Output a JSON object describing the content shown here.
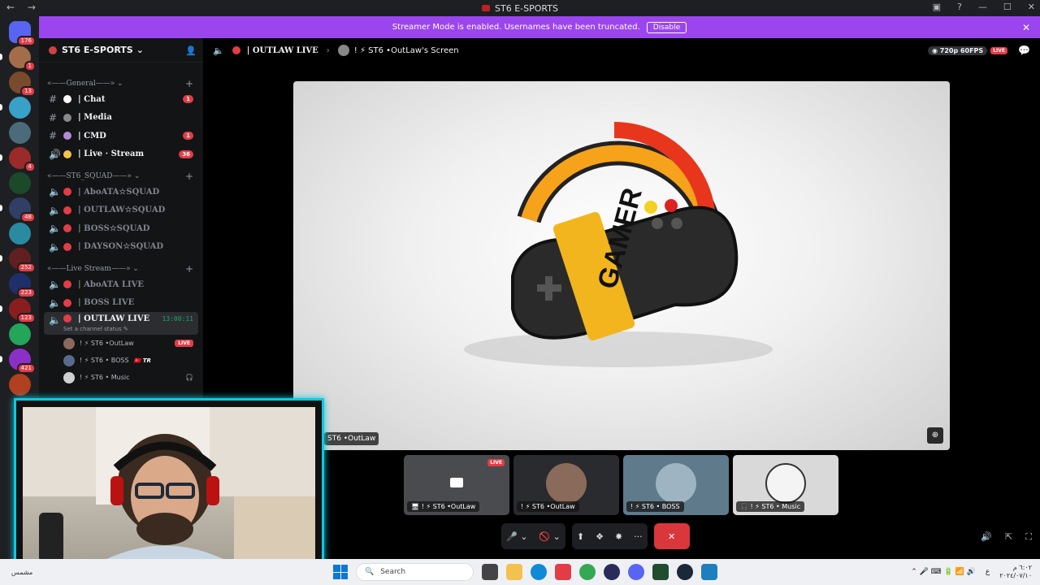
{
  "window": {
    "title": "ST6 E-SPORTS",
    "back": "←",
    "forward": "→",
    "controls": [
      "▣",
      "?",
      "—",
      "☐",
      "✕"
    ]
  },
  "banner": {
    "text": "Streamer Mode is enabled. Usernames have been truncated.",
    "button": "Disable",
    "close": "✕"
  },
  "servers": [
    {
      "badge": "176",
      "color": "#5865f2"
    },
    {
      "badge": "1",
      "color": "#a46d4a"
    },
    {
      "badge": "13",
      "color": "#7a4a2c"
    },
    {
      "badge": "",
      "color": "#39a0c8"
    },
    {
      "badge": "",
      "color": "#4b6b7a"
    },
    {
      "badge": "4",
      "color": "#9b2a2a"
    },
    {
      "badge": "",
      "color": "#1b4a2a"
    },
    {
      "badge": "48",
      "color": "#2f3f66"
    },
    {
      "badge": "",
      "color": "#2a8aa0"
    },
    {
      "badge": "252",
      "color": "#602020"
    },
    {
      "badge": "223",
      "color": "#1e2f6a"
    },
    {
      "badge": "123",
      "color": "#8a1e1e"
    },
    {
      "badge": "",
      "color": "#23a55a"
    },
    {
      "badge": "421",
      "color": "#8b2fc9"
    },
    {
      "badge": "",
      "color": "#b04020"
    }
  ],
  "guild": {
    "name": "ST6 E-SPORTS",
    "chevron": "⌄",
    "add_user": "👤"
  },
  "categories": [
    {
      "name": "«——General——» ⌄",
      "plus": "+"
    },
    {
      "name": "«——ST6_SQUAD——» ⌄",
      "plus": "+"
    },
    {
      "name": "«——Live Stream——» ⌄",
      "plus": "+"
    }
  ],
  "text_channels": [
    {
      "icon": "#",
      "emoji_color": "#ffffff",
      "name": "| Chat",
      "count": "1"
    },
    {
      "icon": "#",
      "emoji_color": "#8a8a8a",
      "name": "| Media",
      "count": ""
    },
    {
      "icon": "#",
      "emoji_color": "#b28ad6",
      "name": "| CMD",
      "count": "1"
    },
    {
      "icon": "🔊",
      "emoji_color": "#f5c542",
      "name": "| Live · Stream",
      "count": "36"
    }
  ],
  "squad_channels": [
    {
      "icon": "🔈",
      "name": "| AboATA☆SQUAD"
    },
    {
      "icon": "🔈",
      "name": "| OUTLAW☆SQUAD"
    },
    {
      "icon": "🔈",
      "name": "| BOSS☆SQUAD"
    },
    {
      "icon": "🔈",
      "name": "| DAYSON☆SQUAD"
    }
  ],
  "live_channels": [
    {
      "icon": "🔈",
      "name": "| AboATA LIVE"
    },
    {
      "icon": "🔈",
      "name": "| BOSS LIVE"
    }
  ],
  "active_channel": {
    "icon": "🔈",
    "name": "| OUTLAW LIVE",
    "timer": "13:00:11",
    "status": "Set a channel status ✎"
  },
  "voice_users": [
    {
      "name": "! ⚡ ST6 •OutLaw",
      "live": "LIVE",
      "tag": "",
      "extra": ""
    },
    {
      "name": "! ⚡ ST6 • BOSS",
      "live": "",
      "tag": "🇹🇷 TR",
      "extra": ""
    },
    {
      "name": "! ⚡ ST6 • Music",
      "live": "",
      "tag": "",
      "extra": "🎧"
    }
  ],
  "stage": {
    "voice_icon": "🔈",
    "channel": "| OUTLAW LIVE",
    "separator": "›",
    "screen_title": "! ⚡ ST6 •OutLaw's Screen",
    "quality": "◉ 720p 60FPS",
    "live": "LIVE",
    "chat_icon": "💬",
    "stream_label": "ST6 •OutLaw",
    "zoom_icon": "⊕"
  },
  "tiles": [
    {
      "label": "🖥 ! ⚡ ST6 •OutLaw",
      "live": "LIVE",
      "bg": "#4a4b4f"
    },
    {
      "label": "! ⚡ ST6 •OutLaw",
      "live": "",
      "bg": "#2a2b2f"
    },
    {
      "label": "! ⚡ ST6 • BOSS",
      "live": "",
      "bg": "#5f7a8a"
    },
    {
      "label": "🎧 ! ⚡ ST6 • Music",
      "live": "",
      "bg": "#d9d9d9"
    }
  ],
  "controls": {
    "mic": "🎤 ⌄",
    "camera": "🚫 ⌄",
    "share": "⬆",
    "activities": "❖",
    "soundboard": "✸",
    "more": "···",
    "end": "✕"
  },
  "bottom_right": {
    "volume": "🔊",
    "popout": "⇱",
    "fullscreen": "⛶"
  },
  "taskbar": {
    "weather": "مشمس",
    "search_icon": "🔍",
    "search": "Search",
    "lang": "ع",
    "time": "٦:٠٢ م",
    "date": "٢٠٢٤/٠٧/١٠",
    "tray": "⌃ 🎤 ⌨ 🔋 📶 🔊"
  }
}
